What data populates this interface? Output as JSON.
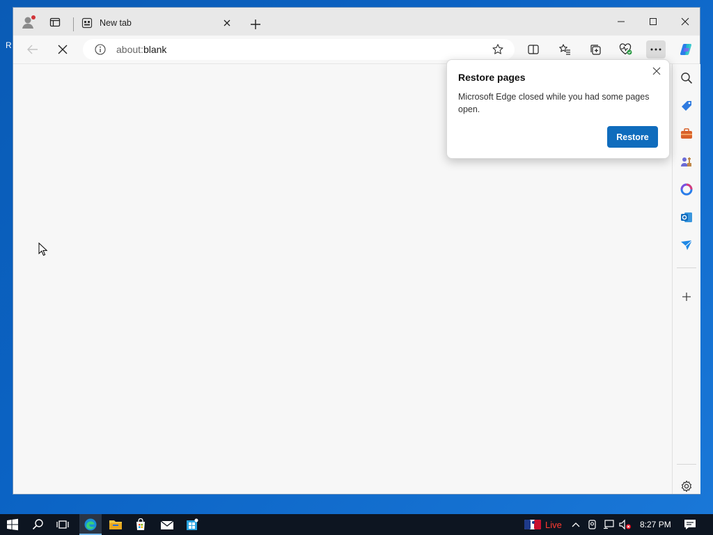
{
  "browser": {
    "tab": {
      "title": "New tab"
    },
    "address": {
      "scheme": "about:",
      "path": "blank"
    }
  },
  "popup": {
    "title": "Restore pages",
    "message": "Microsoft Edge closed while you had some pages open.",
    "restore_label": "Restore"
  },
  "taskbar": {
    "live_label": "Live",
    "time": "8:27 PM"
  },
  "colors": {
    "accent": "#0f6cbd",
    "desktop": "#0b63c4",
    "taskbar": "#0d1521",
    "live": "#ff3b30"
  }
}
